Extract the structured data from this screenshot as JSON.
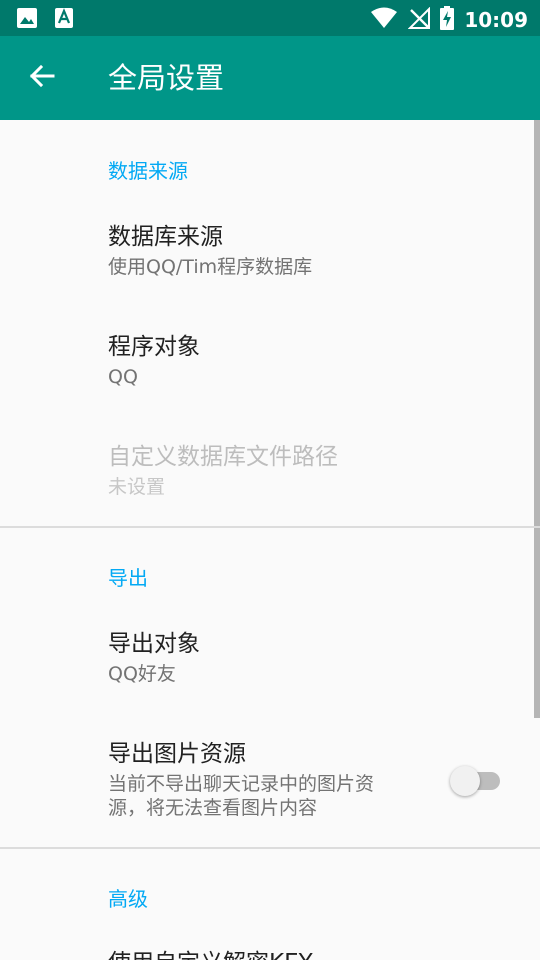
{
  "status_bar": {
    "time": "10:09",
    "icons": [
      "image-icon",
      "a-font-icon",
      "wifi-icon",
      "no-signal-icon",
      "battery-charging-icon"
    ]
  },
  "app_bar": {
    "title": "全局设置",
    "back_icon": "arrow-left-icon"
  },
  "sections": {
    "data_source": {
      "header": "数据来源",
      "database_source": {
        "title": "数据库来源",
        "summary": "使用QQ/Tim程序数据库"
      },
      "program_target": {
        "title": "程序对象",
        "summary": "QQ"
      },
      "custom_db_path": {
        "title": "自定义数据库文件路径",
        "summary": "未设置",
        "enabled": false
      }
    },
    "export": {
      "header": "导出",
      "export_target": {
        "title": "导出对象",
        "summary": "QQ好友"
      },
      "export_images": {
        "title": "导出图片资源",
        "summary": "当前不导出聊天记录中的图片资源，将无法查看图片内容",
        "checked": false
      }
    },
    "advanced": {
      "header": "高级",
      "custom_key": {
        "title": "使用自定义解密KEY"
      }
    }
  },
  "colors": {
    "status_bar": "#00796b",
    "app_bar": "#009688",
    "accent": "#03a9f4",
    "background": "#fafafa"
  }
}
